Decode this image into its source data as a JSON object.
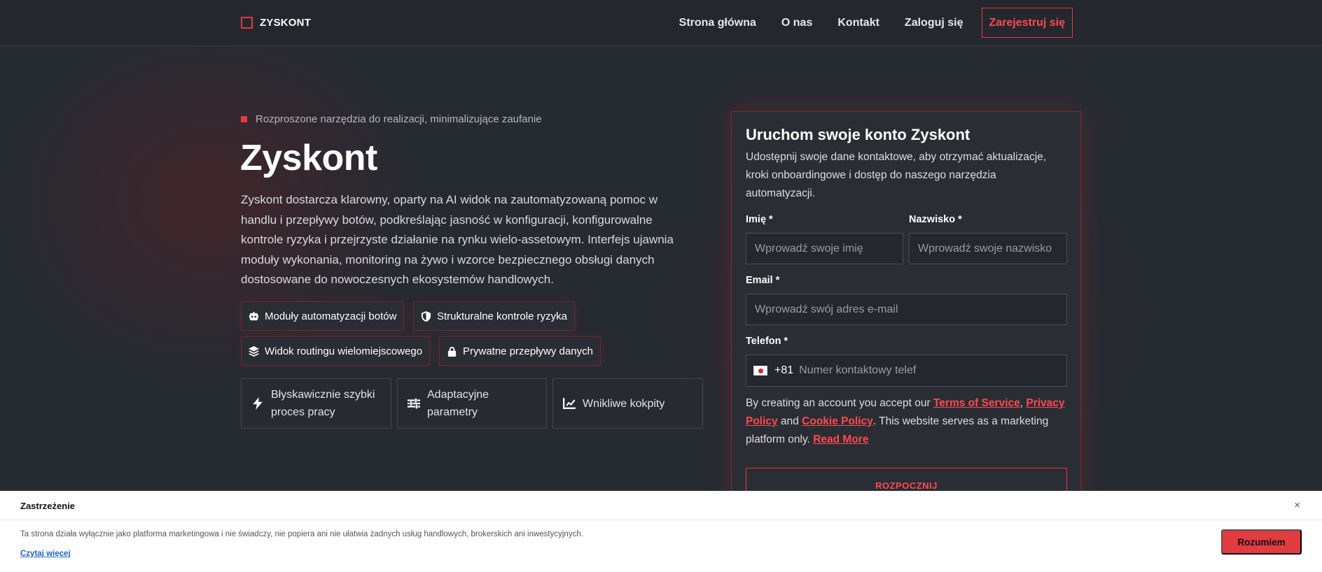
{
  "nav": {
    "logo": "ZYSKONT",
    "links": [
      "Strona główna",
      "O nas",
      "Kontakt",
      "Zaloguj się"
    ],
    "cta": "Zarejestruj się"
  },
  "hero": {
    "eyebrow": "Rozproszone narzędzia do realizacji, minimalizujące zaufanie",
    "title": "Zyskont",
    "description": "Zyskont dostarcza klarowny, oparty na AI widok na zautomatyzowaną pomoc w handlu i przepływy botów, podkreślając jasność w konfiguracji, konfigurowalne kontrole ryzyka i przejrzyste działanie na rynku wielo-assetowym. Interfejs ujawnia moduły wykonania, monitoring na żywo i wzorce bezpiecznego obsługi danych dostosowane do nowoczesnych ekosystemów handlowych.",
    "chips": [
      {
        "label": "Moduły automatyzacji botów",
        "icon": "robot-icon"
      },
      {
        "label": "Strukturalne kontrole ryzyka",
        "icon": "shield-icon"
      },
      {
        "label": "Widok routingu wielomiejscowego",
        "icon": "layers-icon"
      },
      {
        "label": "Prywatne przepływy danych",
        "icon": "lock-icon"
      }
    ],
    "features": [
      {
        "label": "Błyskawicznie szybki proces pracy",
        "icon": "lightning-icon"
      },
      {
        "label": "Adaptacyjne parametry",
        "icon": "sliders-icon"
      },
      {
        "label": "Wnikliwe kokpity",
        "icon": "chart-line-icon"
      }
    ]
  },
  "form": {
    "title": "Uruchom swoje konto Zyskont",
    "subtitle": "Udostępnij swoje dane kontaktowe, aby otrzymać aktualizacje, kroki onboardingowe i dostęp do naszego narzędzia automatyzacji.",
    "first_name_label": "Imię *",
    "first_name_placeholder": "Wprowadź swoje imię",
    "last_name_label": "Nazwisko *",
    "last_name_placeholder": "Wprowadź swoje nazwisko",
    "email_label": "Email *",
    "email_placeholder": "Wprowadź swój adres e-mail",
    "phone_label": "Telefon *",
    "phone_code": "+81",
    "phone_placeholder": "Numer kontaktowy telef",
    "legal_prefix": "By creating an account you accept our ",
    "terms": "Terms of Service",
    "comma": ", ",
    "privacy": "Privacy Policy",
    "and": " and ",
    "cookie": "Cookie Policy",
    "legal_suffix": ". This website serves as a marketing platform only. ",
    "read_more": "Read More",
    "submit": "ROZPOCZNIJ"
  },
  "disclaimer": {
    "title": "Zastrzeżenie",
    "close": "×",
    "text": "Ta strona działa wyłącznie jako platforma marketingowa i nie świadczy, nie popiera ani nie ułatwia żadnych usług handlowych, brokerskich ani inwestycyjnych.",
    "link": "Czytaj więcej",
    "button": "Rozumiem"
  },
  "colors": {
    "accent": "#e8373f",
    "background": "#262a31",
    "nav": "#24272d"
  }
}
